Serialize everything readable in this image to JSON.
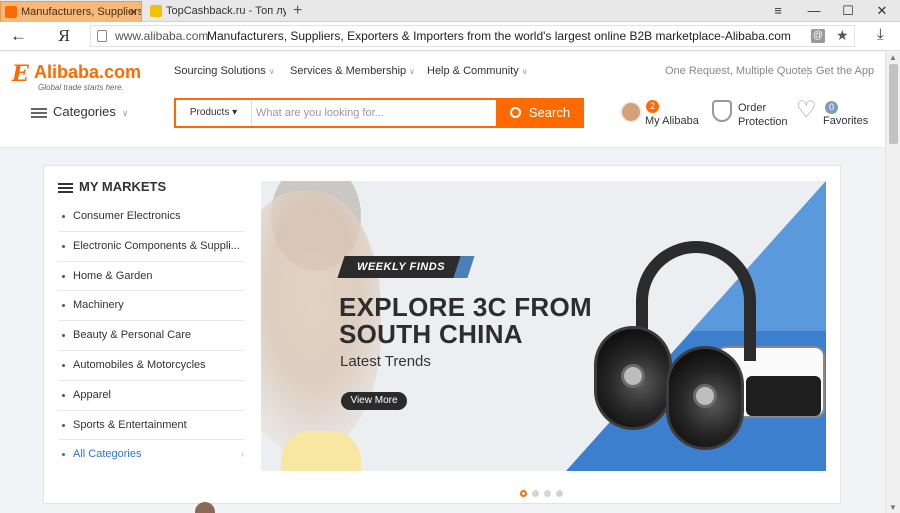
{
  "browser": {
    "tabs": [
      {
        "title": "Manufacturers, Suppliers",
        "close": "×",
        "active": true
      },
      {
        "title": "TopCashback.ru - Топ лучш",
        "close": "",
        "active": false
      }
    ],
    "new_tab": "+",
    "window_buttons": {
      "menu": "≡",
      "minimize": "—",
      "maximize": "☐",
      "close": "✕"
    },
    "back": "←",
    "logo_glyph": "Я",
    "url_domain": "www.alibaba.com",
    "page_title": "Manufacturers, Suppliers, Exporters & Importers from the world's largest online B2B marketplace-Alibaba.com",
    "reader_mode": "@",
    "bookmark": "★",
    "download": "⤓"
  },
  "header": {
    "logo": {
      "mark": "E",
      "word": "Alibaba.com",
      "tagline": "Global trade starts here."
    },
    "nav": [
      "Sourcing Solutions",
      "Services & Membership",
      "Help & Community"
    ],
    "nav_chevron": "∨",
    "links": {
      "request": "One Request, Multiple Quotes",
      "app": "Get the App"
    },
    "categories": "Categories",
    "categories_chevron": "∨",
    "search": {
      "category": "Products ▾",
      "placeholder": "What are you looking for...",
      "button": "Search"
    },
    "my_alibaba": {
      "label": "My Alibaba",
      "count": "2"
    },
    "order_protection": {
      "line1": "Order",
      "line2": "Protection"
    },
    "favorites": {
      "label": "Favorites",
      "count": "0"
    },
    "heart": "♡"
  },
  "markets": {
    "title": "MY MARKETS",
    "items": [
      "Consumer Electronics",
      "Electronic Components & Suppli...",
      "Home & Garden",
      "Machinery",
      "Beauty & Personal Care",
      "Automobiles & Motorcycles",
      "Apparel",
      "Sports & Entertainment"
    ],
    "all": "All Categories",
    "all_chevron": "›"
  },
  "banner": {
    "tag": "WEEKLY FINDS",
    "headline1": "EXPLORE 3C FROM",
    "headline2": "SOUTH CHINA",
    "subtitle": "Latest Trends",
    "button": "View More",
    "slides": 4,
    "active_slide": 1
  },
  "colors": {
    "brand": "#ff6a00",
    "link": "#2f74c5",
    "active_tab": "#f7b97a",
    "banner_blue": "#3b7fce"
  }
}
